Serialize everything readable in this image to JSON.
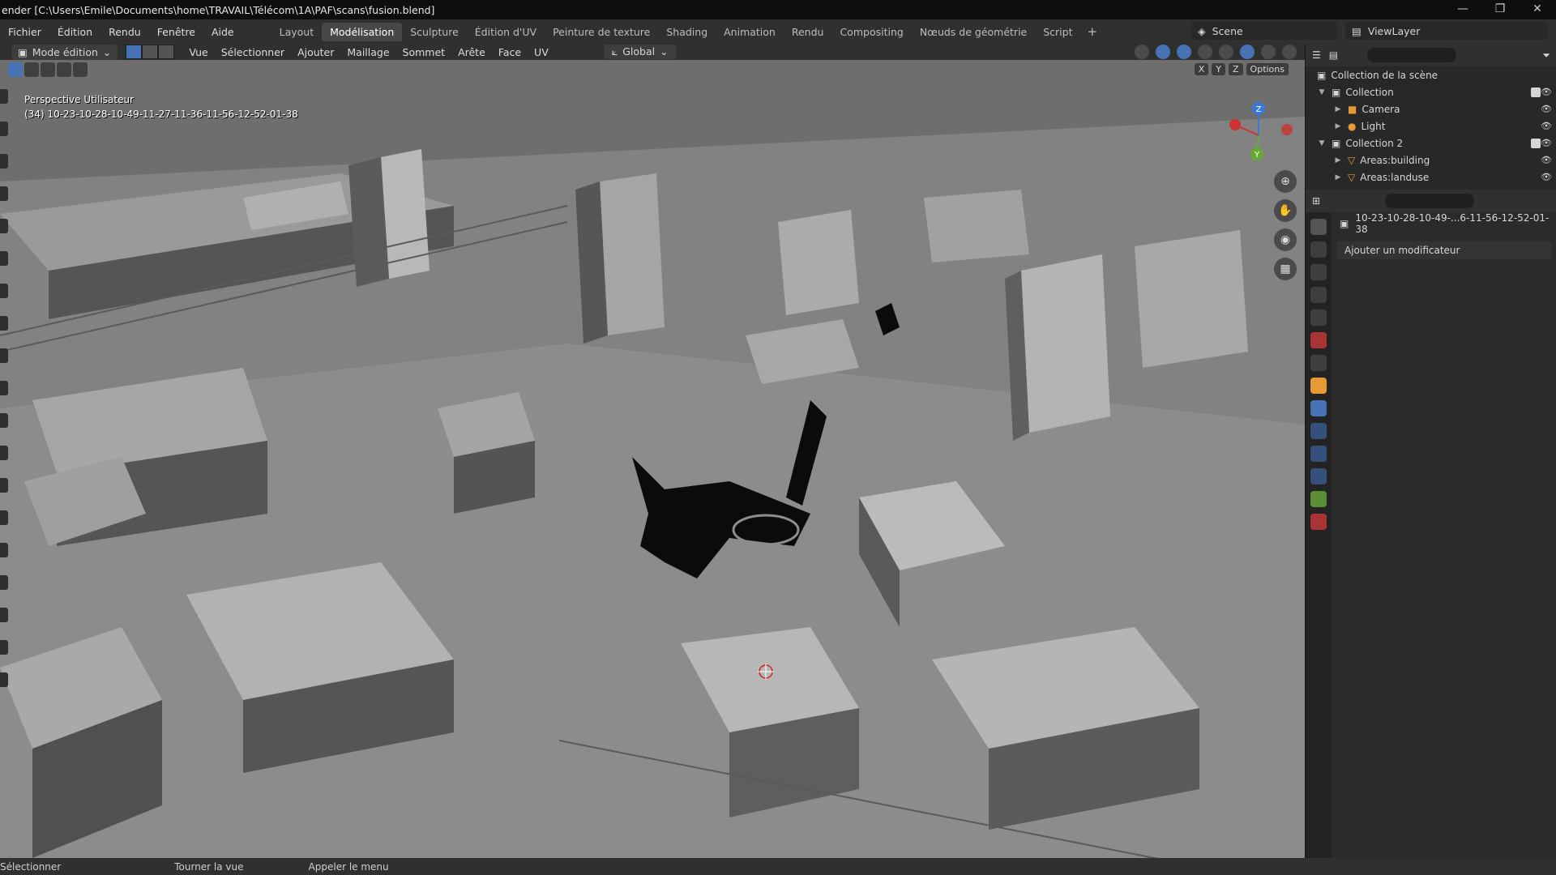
{
  "window": {
    "title": "ender [C:\\Users\\Emile\\Documents\\home\\TRAVAIL\\Télécom\\1A\\PAF\\scans\\fusion.blend]",
    "controls": [
      "—",
      "❐",
      "✕"
    ]
  },
  "menubar": {
    "menus": [
      "Fichier",
      "Édition",
      "Rendu",
      "Fenêtre",
      "Aide"
    ],
    "workspaces": [
      "Layout",
      "Modélisation",
      "Sculpture",
      "Édition d'UV",
      "Peinture de texture",
      "Shading",
      "Animation",
      "Rendu",
      "Compositing",
      "Nœuds de géométrie",
      "Script"
    ],
    "active_workspace": "Modélisation",
    "add_tab": "+",
    "scene": "Scene",
    "view_layer": "ViewLayer"
  },
  "viewport_header": {
    "mode": "Mode édition",
    "menus": [
      "Vue",
      "Sélectionner",
      "Ajouter",
      "Maillage",
      "Sommet",
      "Arête",
      "Face",
      "UV"
    ],
    "orientation": "Global",
    "options": "Options",
    "axes": [
      "X",
      "Y",
      "Z"
    ]
  },
  "viewport": {
    "view_name": "Perspective Utilisateur",
    "object_label": "(34) 10-23-10-28-10-49-11-27-11-36-11-56-12-52-01-38",
    "gizmo": {
      "z": "Z",
      "y": "Y"
    }
  },
  "outliner": {
    "root": "Collection de la scène",
    "items": [
      {
        "label": "Collection",
        "level": 1,
        "icon": "collection-icon"
      },
      {
        "label": "Camera",
        "level": 2,
        "icon": "camera-icon"
      },
      {
        "label": "Light",
        "level": 2,
        "icon": "light-icon"
      },
      {
        "label": "Collection 2",
        "level": 1,
        "icon": "collection-icon"
      },
      {
        "label": "Areas:building",
        "level": 2,
        "icon": "mesh-icon"
      },
      {
        "label": "Areas:landuse",
        "level": 2,
        "icon": "mesh-icon"
      }
    ]
  },
  "properties": {
    "object_name": "10-23-10-28-10-49-...6-11-56-12-52-01-38",
    "add_modifier": "Ajouter un modificateur"
  },
  "statusbar": {
    "items": [
      "Sélectionner",
      "Tourner la vue",
      "Appeler le menu"
    ]
  },
  "colors": {
    "accent": "#4772b3",
    "viewport_bg": "#6f6f6f",
    "building_top": "#a9a9a9",
    "building_side": "#595959",
    "mesh_selected": "#0b0b0b"
  }
}
